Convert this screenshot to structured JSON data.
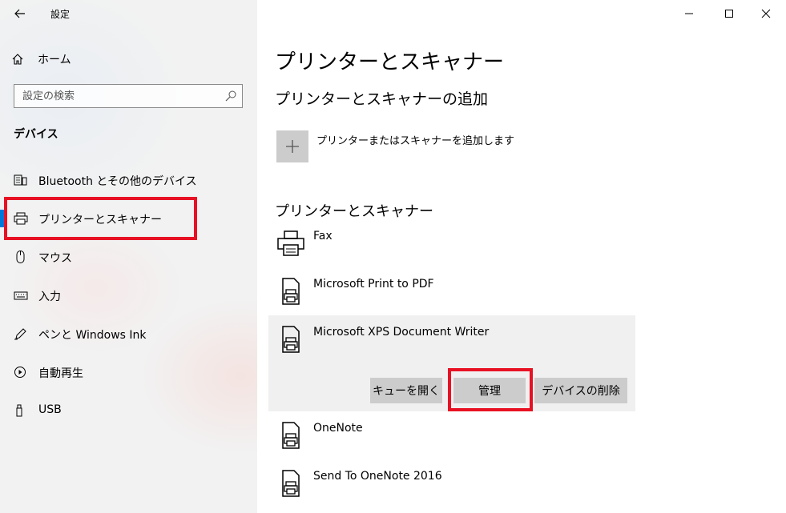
{
  "app": {
    "title": "設定"
  },
  "sidebar": {
    "home_label": "ホーム",
    "search_placeholder": "設定の検索",
    "section_title": "デバイス",
    "items": [
      {
        "label": "Bluetooth とその他のデバイス",
        "icon": "bluetooth-device-icon"
      },
      {
        "label": "プリンターとスキャナー",
        "icon": "printer-icon",
        "selected": true
      },
      {
        "label": "マウス",
        "icon": "mouse-icon"
      },
      {
        "label": "入力",
        "icon": "keyboard-icon"
      },
      {
        "label": "ペンと Windows Ink",
        "icon": "pen-icon"
      },
      {
        "label": "自動再生",
        "icon": "autoplay-icon"
      },
      {
        "label": "USB",
        "icon": "usb-icon"
      }
    ]
  },
  "main": {
    "title": "プリンターとスキャナー",
    "add_section_title": "プリンターとスキャナーの追加",
    "add_label": "プリンターまたはスキャナーを追加します",
    "list_title": "プリンターとスキャナー",
    "printers": [
      {
        "name": "Fax",
        "icon": "fax-icon"
      },
      {
        "name": "Microsoft Print to PDF",
        "icon": "printer-document-icon"
      },
      {
        "name": "Microsoft XPS Document Writer",
        "icon": "printer-document-icon",
        "selected": true
      },
      {
        "name": "OneNote",
        "icon": "printer-document-icon"
      },
      {
        "name": "Send To OneNote 2016",
        "icon": "printer-document-icon"
      }
    ],
    "actions": {
      "open_queue": "キューを開く",
      "manage": "管理",
      "remove_device": "デバイスの削除"
    }
  },
  "colors": {
    "accent": "#0078d7",
    "highlight_box": "#e81123",
    "button_bg": "#cccccc",
    "selected_row_bg": "#f0f0f0"
  }
}
